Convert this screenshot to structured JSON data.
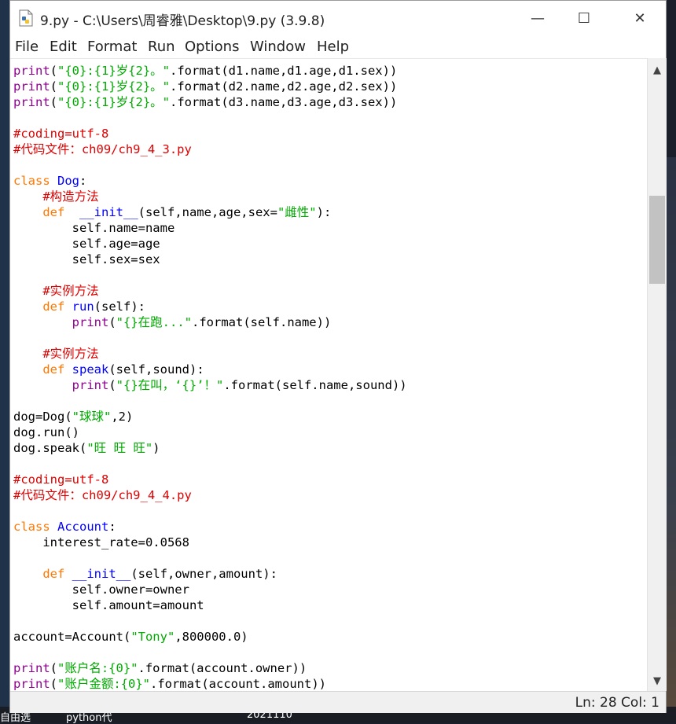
{
  "window": {
    "title": "9.py - C:\\Users\\周睿雅\\Desktop\\9.py (3.9.8)",
    "minimize_glyph": "—",
    "maximize_glyph": "☐",
    "close_glyph": "✕"
  },
  "menu": [
    "File",
    "Edit",
    "Format",
    "Run",
    "Options",
    "Window",
    "Help"
  ],
  "code_lines": [
    [
      [
        "bi",
        "print"
      ],
      [
        "",
        "("
      ],
      [
        "str",
        "\"{0}:{1}岁{2}。\""
      ],
      [
        "",
        ".format(d1.name,d1.age,d1.sex))"
      ]
    ],
    [
      [
        "bi",
        "print"
      ],
      [
        "",
        "("
      ],
      [
        "str",
        "\"{0}:{1}岁{2}。\""
      ],
      [
        "",
        ".format(d2.name,d2.age,d2.sex))"
      ]
    ],
    [
      [
        "bi",
        "print"
      ],
      [
        "",
        "("
      ],
      [
        "str",
        "\"{0}:{1}岁{2}。\""
      ],
      [
        "",
        ".format(d3.name,d3.age,d3.sex))"
      ]
    ],
    [],
    [
      [
        "com",
        "#coding=utf-8"
      ]
    ],
    [
      [
        "com",
        "#代码文件：ch09/ch9_4_3.py"
      ]
    ],
    [],
    [
      [
        "kw",
        "class"
      ],
      [
        "",
        " "
      ],
      [
        "fn",
        "Dog"
      ],
      [
        "",
        ":"
      ]
    ],
    [
      [
        "",
        "    "
      ],
      [
        "com",
        "#构造方法"
      ]
    ],
    [
      [
        "",
        "    "
      ],
      [
        "kw",
        "def"
      ],
      [
        "",
        "  "
      ],
      [
        "fn",
        "__init__"
      ],
      [
        "",
        "(self,name,age,sex="
      ],
      [
        "str",
        "\"雌性\""
      ],
      [
        "",
        "):"
      ]
    ],
    [
      [
        "",
        "        self.name=name"
      ]
    ],
    [
      [
        "",
        "        self.age=age"
      ]
    ],
    [
      [
        "",
        "        self.sex=sex"
      ]
    ],
    [],
    [
      [
        "",
        "    "
      ],
      [
        "com",
        "#实例方法"
      ]
    ],
    [
      [
        "",
        "    "
      ],
      [
        "kw",
        "def"
      ],
      [
        "",
        " "
      ],
      [
        "fn",
        "run"
      ],
      [
        "",
        "(self):"
      ]
    ],
    [
      [
        "",
        "        "
      ],
      [
        "bi",
        "print"
      ],
      [
        "",
        "("
      ],
      [
        "str",
        "\"{}在跑...\""
      ],
      [
        "",
        ".format(self.name))"
      ]
    ],
    [],
    [
      [
        "",
        "    "
      ],
      [
        "com",
        "#实例方法"
      ]
    ],
    [
      [
        "",
        "    "
      ],
      [
        "kw",
        "def"
      ],
      [
        "",
        " "
      ],
      [
        "fn",
        "speak"
      ],
      [
        "",
        "(self,sound):"
      ]
    ],
    [
      [
        "",
        "        "
      ],
      [
        "bi",
        "print"
      ],
      [
        "",
        "("
      ],
      [
        "str",
        "\"{}在叫，‘{}’！\""
      ],
      [
        "",
        ".format(self.name,sound))"
      ]
    ],
    [],
    [
      [
        "",
        "dog=Dog("
      ],
      [
        "str",
        "\"球球\""
      ],
      [
        "",
        ",2)"
      ]
    ],
    [
      [
        "",
        "dog.run()"
      ]
    ],
    [
      [
        "",
        "dog.speak("
      ],
      [
        "str",
        "\"旺 旺 旺\""
      ],
      [
        "",
        ")"
      ]
    ],
    [],
    [
      [
        "com",
        "#coding=utf-8"
      ]
    ],
    [
      [
        "com",
        "#代码文件：ch09/ch9_4_4.py"
      ]
    ],
    [],
    [
      [
        "kw",
        "class"
      ],
      [
        "",
        " "
      ],
      [
        "fn",
        "Account"
      ],
      [
        "",
        ":"
      ]
    ],
    [
      [
        "",
        "    interest_rate=0.0568"
      ]
    ],
    [],
    [
      [
        "",
        "    "
      ],
      [
        "kw",
        "def"
      ],
      [
        "",
        " "
      ],
      [
        "fn",
        "__init__"
      ],
      [
        "",
        "(self,owner,amount):"
      ]
    ],
    [
      [
        "",
        "        self.owner=owner"
      ]
    ],
    [
      [
        "",
        "        self.amount=amount"
      ]
    ],
    [],
    [
      [
        "",
        "account=Account("
      ],
      [
        "str",
        "\"Tony\""
      ],
      [
        "",
        ",800000.0)"
      ]
    ],
    [],
    [
      [
        "bi",
        "print"
      ],
      [
        "",
        "("
      ],
      [
        "str",
        "\"账户名:{0}\""
      ],
      [
        "",
        ".format(account.owner))"
      ]
    ],
    [
      [
        "bi",
        "print"
      ],
      [
        "",
        "("
      ],
      [
        "str",
        "\"账户金额:{0}\""
      ],
      [
        "",
        ".format(account.amount))"
      ]
    ]
  ],
  "scrollbar": {
    "up_glyph": "▲",
    "down_glyph": "▼",
    "position": 0.23
  },
  "status": {
    "text": "Ln: 28   Col: 1"
  },
  "taskbar": {
    "items": [
      "自由选",
      "python代",
      "2021110"
    ]
  },
  "colors": {
    "keyword": "#ff7700",
    "definition": "#0000ff",
    "builtin": "#900090",
    "string": "#00aa00",
    "comment": "#dd0000"
  }
}
